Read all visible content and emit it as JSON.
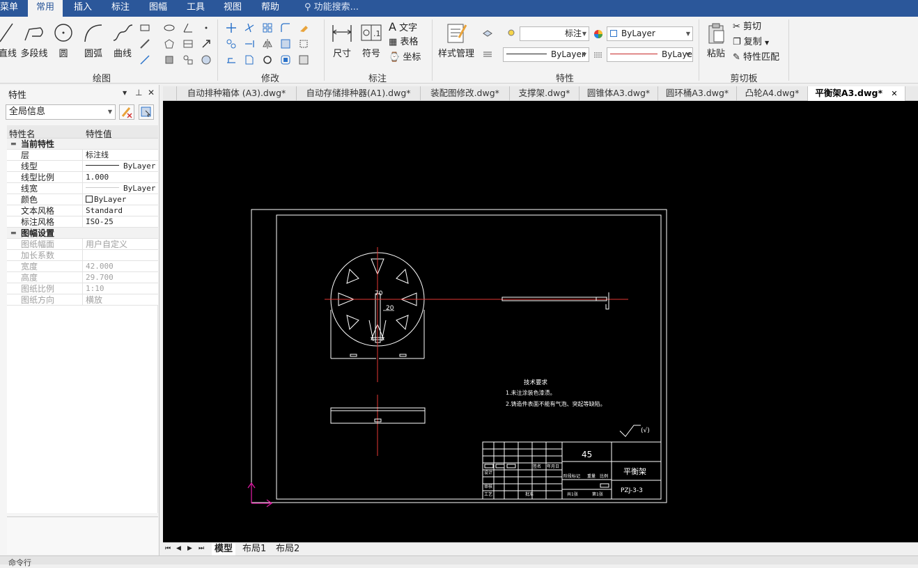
{
  "menu": {
    "items": [
      "菜单",
      "常用",
      "插入",
      "标注",
      "图幅",
      "工具",
      "视图",
      "帮助"
    ],
    "active": "常用",
    "search_placeholder": "功能搜索..."
  },
  "ribbon": {
    "draw": {
      "label": "绘图",
      "buttons": [
        "直线",
        "多段线",
        "圆",
        "圆弧",
        "曲线"
      ]
    },
    "modify": {
      "label": "修改"
    },
    "dimension": {
      "label": "标注",
      "buttons": [
        "尺寸",
        "符号"
      ],
      "small": [
        "文字",
        "表格",
        "坐标"
      ]
    },
    "style": {
      "label": "样式管理"
    },
    "properties": {
      "label": "特性",
      "layer_combo": "标注",
      "color_combo": "ByLayer",
      "linetype_combo": "ByLayer",
      "lineweight_combo": "ByLaye"
    },
    "clipboard": {
      "label": "剪切板",
      "paste": "粘贴",
      "cut": "剪切",
      "copy": "复制",
      "match": "特性匹配"
    }
  },
  "panel": {
    "title": "特性",
    "selector": "全局信息",
    "headers": {
      "name": "特性名",
      "value": "特性值"
    },
    "current": {
      "title": "当前特性",
      "rows": [
        {
          "name": "层",
          "value": "标注线"
        },
        {
          "name": "线型",
          "value": "ByLayer"
        },
        {
          "name": "线型比例",
          "value": "1.000"
        },
        {
          "name": "线宽",
          "value": "ByLayer"
        },
        {
          "name": "颜色",
          "value": "ByLayer"
        },
        {
          "name": "文本风格",
          "value": "Standard"
        },
        {
          "name": "标注风格",
          "value": "ISO-25"
        }
      ]
    },
    "sheet": {
      "title": "图幅设置",
      "rows": [
        {
          "name": "图纸幅面",
          "value": "用户自定义"
        },
        {
          "name": "加长系数",
          "value": ""
        },
        {
          "name": "宽度",
          "value": "42.000"
        },
        {
          "name": "高度",
          "value": "29.700"
        },
        {
          "name": "图纸比例",
          "value": "1:10"
        },
        {
          "name": "图纸方向",
          "value": "横放"
        }
      ]
    }
  },
  "tabs": [
    "自动排种箱体 (A3).dwg*",
    "自动存储排种器(A1).dwg*",
    "装配图修改.dwg*",
    "支撑架.dwg*",
    "圆锥体A3.dwg*",
    "圆环桶A3.dwg*",
    "凸轮A4.dwg*",
    "平衡架A3.dwg*"
  ],
  "active_tab": "平衡架A3.dwg*",
  "drawing": {
    "tech_title": "技术要求",
    "tech_1": "1.未注涂装色漆渍。",
    "tech_2": "2.铸造件表面不能有气泡、突起等缺陷。",
    "dim_70": "70",
    "dim_20": "20",
    "roughness": "(√)",
    "title_material": "45",
    "title_name": "平衡架",
    "title_code": "PZJ-3-3",
    "title_stage": "阶段标记",
    "title_weight": "重量",
    "title_scale": "比例",
    "title_sheets": "共1张",
    "title_sheet": "第1张",
    "title_design": "设计",
    "title_check": "审核",
    "title_process": "工艺",
    "title_approve": "批准",
    "title_sign": "签名",
    "title_date": "年月日"
  },
  "layouts": [
    "模型",
    "布局1",
    "布局2"
  ],
  "active_layout": "模型",
  "status": "命令行"
}
